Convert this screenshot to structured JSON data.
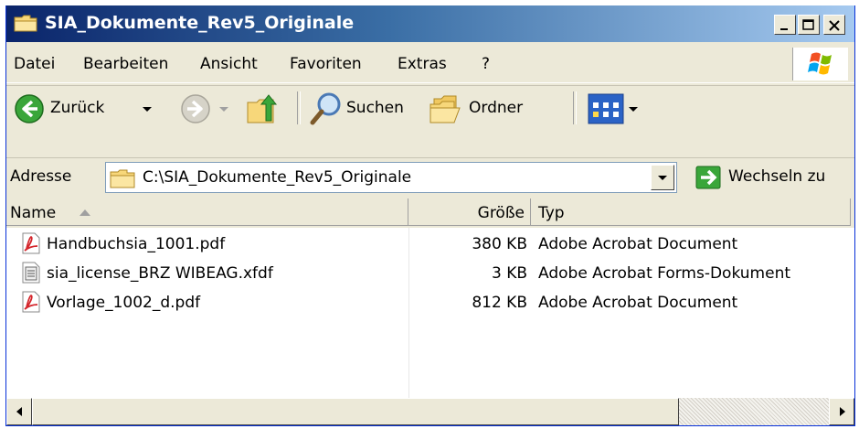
{
  "window": {
    "title": "SIA_Dokumente_Rev5_Originale",
    "controls": {
      "minimize": "_",
      "maximize": "□",
      "close": "×"
    }
  },
  "menubar": {
    "items": [
      "Datei",
      "Bearbeiten",
      "Ansicht",
      "Favoriten",
      "Extras",
      "?"
    ]
  },
  "toolbar": {
    "back_label": "Zurück",
    "search_label": "Suchen",
    "folders_label": "Ordner"
  },
  "addressbar": {
    "label": "Adresse",
    "path": "C:\\SIA_Dokumente_Rev5_Originale",
    "go_label": "Wechseln zu"
  },
  "listview": {
    "columns": {
      "name": "Name",
      "size": "Größe",
      "type": "Typ"
    },
    "files": [
      {
        "name": "Handbuchsia_1001.pdf",
        "size": "380 KB",
        "type": "Adobe Acrobat Document",
        "icon": "pdf-icon"
      },
      {
        "name": "sia_license_BRZ WIBEAG.xfdf",
        "size": "3 KB",
        "type": "Adobe Acrobat Forms-Dokument",
        "icon": "xfdf-icon"
      },
      {
        "name": "Vorlage_1002_d.pdf",
        "size": "812 KB",
        "type": "Adobe Acrobat Document",
        "icon": "pdf-icon"
      }
    ]
  },
  "colors": {
    "titlebar_start": "#0a246a",
    "titlebar_end": "#a6caf0",
    "chrome": "#ece9d8",
    "pdf_red": "#d4252b"
  }
}
